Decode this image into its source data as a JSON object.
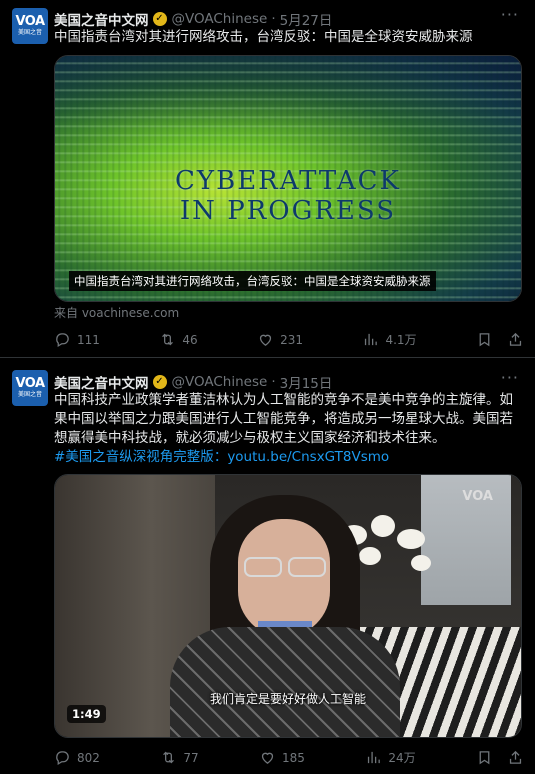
{
  "tweets": [
    {
      "avatar": {
        "logo": "VOA",
        "sub": "美国之音"
      },
      "name": "美国之音中文网",
      "handle": "@VOAChinese",
      "dot": "·",
      "date": "5月27日",
      "text": "中国指责台湾对其进行网络攻击，台湾反驳：中国是全球资安威胁来源",
      "media": {
        "overlay_text_line1": "CYBERATTACK",
        "overlay_text_line2": "IN PROGRESS",
        "caption": "中国指责台湾对其进行网络攻击，台湾反驳：中国是全球资安威胁来源"
      },
      "source": "来自 voachinese.com",
      "actions": {
        "replies": "111",
        "retweets": "46",
        "likes": "231",
        "views": "4.1万"
      }
    },
    {
      "avatar": {
        "logo": "VOA",
        "sub": "美国之音"
      },
      "name": "美国之音中文网",
      "handle": "@VOAChinese",
      "dot": "·",
      "date": "3月15日",
      "text_lines": [
        "中国科技产业政策学者董洁林认为人工智能的竞争不是美中竞争的主旋律。如",
        "果中国以举国之力跟美国进行人工智能竞争，将造成另一场星球大战。美国若",
        "想赢得美中科技战，就必须减少与极权主义国家经济和技术往来。"
      ],
      "hashtag": "#美国之音纵深视角完整版",
      "colon": "：",
      "link": "youtu.be/CnsxGT8Vsmo",
      "media": {
        "watermark": "VOA",
        "subtitle": "我们肯定是要好好做人工智能",
        "duration": "1:49"
      },
      "actions": {
        "replies": "802",
        "retweets": "77",
        "likes": "185",
        "views": "24万"
      }
    }
  ],
  "colors": {
    "background": "#000000",
    "link": "#1d9bf0",
    "muted": "#71767b",
    "verified_badge": "#e2b719"
  },
  "icons": [
    "reply-icon",
    "retweet-icon",
    "like-icon",
    "views-icon",
    "bookmark-icon",
    "share-icon",
    "more-icon",
    "verified-icon"
  ]
}
